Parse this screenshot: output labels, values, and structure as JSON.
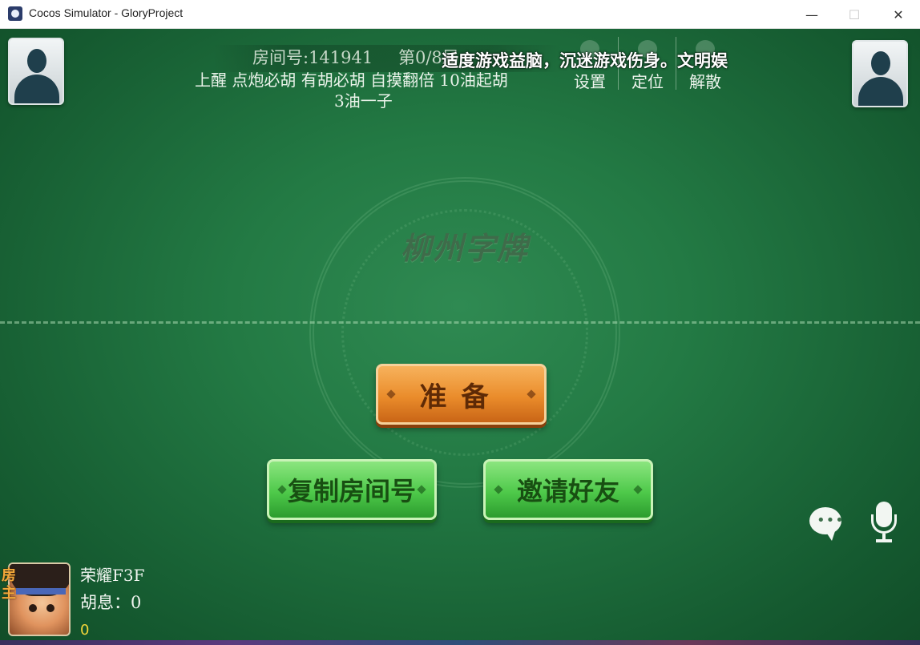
{
  "window": {
    "title": "Cocos Simulator - GloryProject",
    "minimize_glyph": "—",
    "maximize_glyph": "☐",
    "close_glyph": "✕"
  },
  "header": {
    "room_label": "房间号:141941",
    "round_label": "第0/8局",
    "rules_line1": "上醒  点炮必胡  有胡必胡  自摸翻倍  10油起胡",
    "rules_line2": "3油一子",
    "notice": "适度游戏益脑，沉迷游戏伤身。文明娱"
  },
  "top_buttons": {
    "settings": "设置",
    "locate": "定位",
    "dismiss": "解散"
  },
  "table": {
    "emblem_title": "柳州字牌"
  },
  "buttons": {
    "ready": "准备",
    "copy_room": "复制房间号",
    "invite": "邀请好友"
  },
  "chat": {
    "dots": "•••"
  },
  "player": {
    "host_badge": "房主",
    "name": "荣耀F3F",
    "huxi": "胡息：0",
    "score": "0"
  },
  "icons": [
    "app-icon",
    "empty-seat-avatar-icon",
    "settings-icon",
    "locate-icon",
    "dismiss-icon",
    "chat-bubble-icon",
    "microphone-icon",
    "player-avatar"
  ]
}
